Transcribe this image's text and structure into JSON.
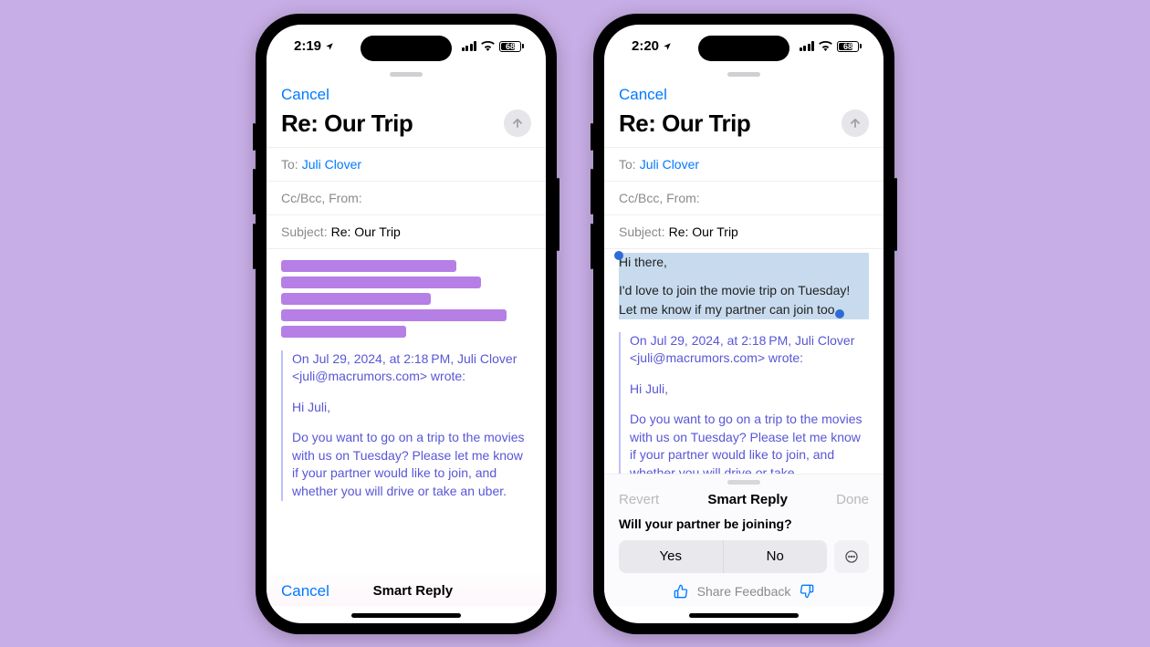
{
  "status": {
    "time1": "2:19",
    "time2": "2:20",
    "battery": "68"
  },
  "nav": {
    "cancel": "Cancel"
  },
  "compose": {
    "title": "Re: Our Trip",
    "to_label": "To:",
    "to_value": "Juli Clover",
    "cc_label": "Cc/Bcc, From:",
    "subject_label": "Subject:",
    "subject_value": "Re: Our Trip"
  },
  "reply_text": {
    "line1": "Hi there,",
    "line2": "I'd love to join the movie trip on Tuesday! Let me know if my partner can join too."
  },
  "quote": {
    "header": "On Jul 29, 2024, at 2:18 PM, Juli Clover <juli@macrumors.com> wrote:",
    "greeting": "Hi Juli,",
    "body_full": "Do you want to go on a trip to the movies with us on Tuesday? Please let me know if your partner would like to join, and whether you will drive or take an uber.",
    "body_trunc": "Do you want to go on a trip to the movies with us on Tuesday? Please let me know if your partner would like to join, and whether you will drive or take"
  },
  "smartreply": {
    "title": "Smart Reply",
    "cancel": "Cancel",
    "revert": "Revert",
    "done": "Done",
    "question": "Will your partner be joining?",
    "opt_yes": "Yes",
    "opt_no": "No",
    "feedback": "Share Feedback"
  }
}
